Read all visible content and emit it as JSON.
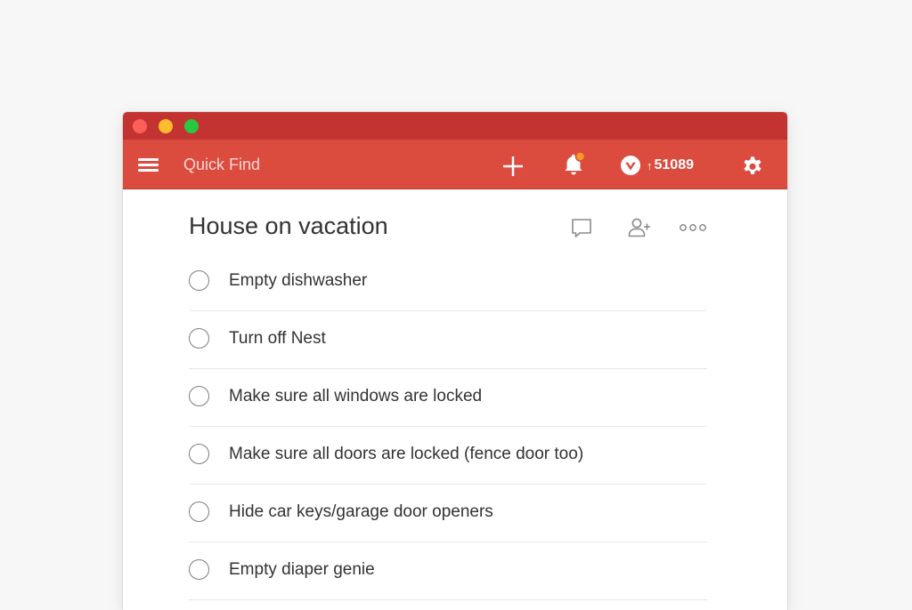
{
  "colors": {
    "titlebar": "#c33331",
    "toolbar": "#db4c3f",
    "notification_dot": "#f59a23"
  },
  "toolbar": {
    "search_placeholder": "Quick Find",
    "karma_value": "51089",
    "karma_arrow": "↑"
  },
  "project": {
    "title": "House on vacation"
  },
  "tasks": [
    {
      "label": "Empty dishwasher"
    },
    {
      "label": "Turn off Nest"
    },
    {
      "label": "Make sure all windows are locked"
    },
    {
      "label": "Make sure all doors are locked (fence door too)"
    },
    {
      "label": "Hide car keys/garage door openers"
    },
    {
      "label": "Empty diaper genie"
    }
  ],
  "icons": {
    "menu": "hamburger-menu-icon",
    "add": "plus-icon",
    "notifications": "bell-icon",
    "karma": "karma-logo-icon",
    "settings": "gear-icon",
    "comments": "comment-icon",
    "share": "add-person-icon",
    "more": "more-horizontal-icon"
  }
}
